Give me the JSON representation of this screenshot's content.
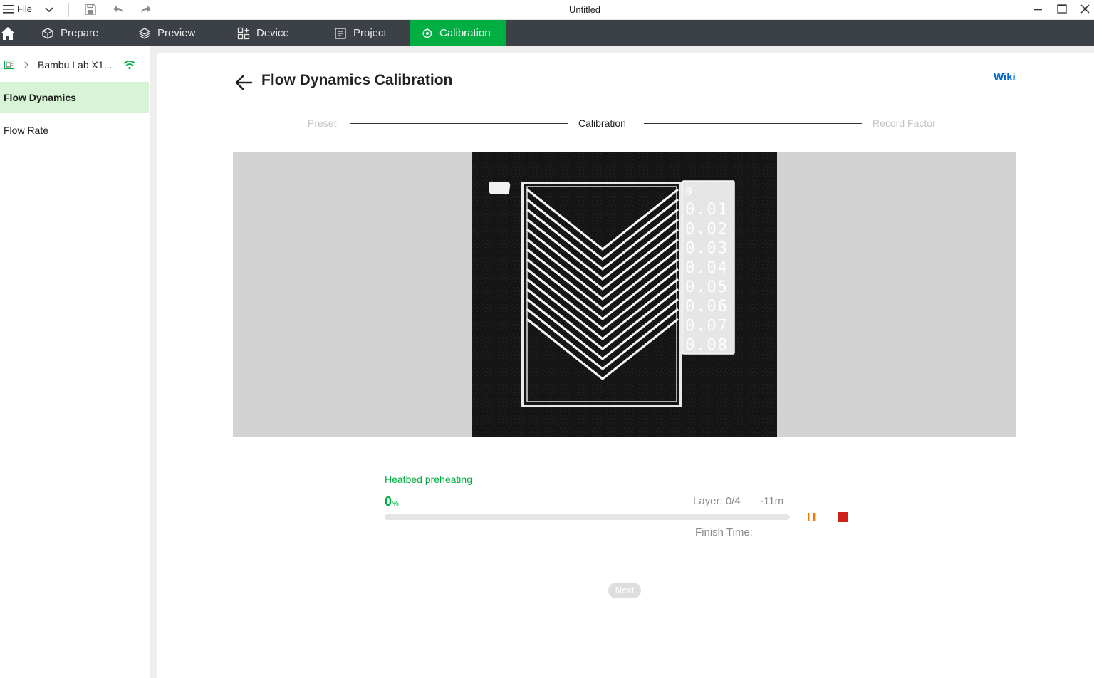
{
  "titlebar": {
    "menu_label": "File",
    "window_title": "Untitled"
  },
  "tabs": [
    {
      "label": "Prepare",
      "icon": "cube-icon"
    },
    {
      "label": "Preview",
      "icon": "layers-icon"
    },
    {
      "label": "Device",
      "icon": "device-icon"
    },
    {
      "label": "Project",
      "icon": "project-icon"
    },
    {
      "label": "Calibration",
      "icon": "calibration-icon",
      "active": true
    }
  ],
  "sidebar": {
    "printer_name": "Bambu Lab X1...",
    "items": [
      {
        "label": "Flow Dynamics",
        "active": true
      },
      {
        "label": "Flow Rate",
        "active": false
      }
    ]
  },
  "page": {
    "title": "Flow Dynamics Calibration",
    "wiki_label": "Wiki"
  },
  "steps": [
    "Preset",
    "Calibration",
    "Record Factor"
  ],
  "current_step": 1,
  "calibration_image": {
    "labels": [
      "0",
      "0.01",
      "0.02",
      "0.03",
      "0.04",
      "0.05",
      "0.06",
      "0.07",
      "0.08"
    ]
  },
  "status": {
    "state": "Heatbed preheating",
    "percent": "0",
    "percent_sign": "%",
    "progress_fraction": 0,
    "layer": "Layer: 0/4",
    "remaining": "-11m",
    "finish_time_label": "Finish Time:"
  },
  "next_label": "Next",
  "colors": {
    "accent": "#00ae42",
    "tabbar": "#3b4146",
    "pause": "#f07800",
    "stop": "#d0201a",
    "link": "#0066cc"
  }
}
